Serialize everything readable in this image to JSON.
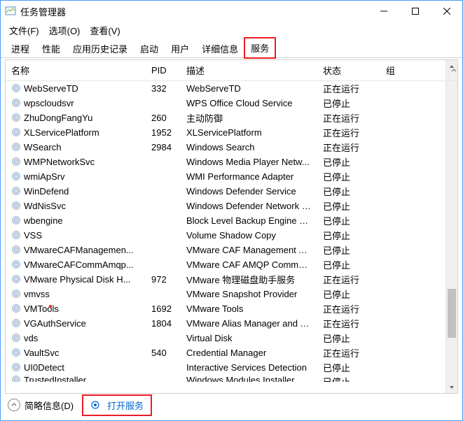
{
  "window": {
    "title": "任务管理器"
  },
  "menu": {
    "file": "文件(F)",
    "options": "选项(O)",
    "view": "查看(V)"
  },
  "tabs": {
    "processes": "进程",
    "performance": "性能",
    "history": "应用历史记录",
    "startup": "启动",
    "users": "用户",
    "details": "详细信息",
    "services": "服务"
  },
  "columns": {
    "name": "名称",
    "pid": "PID",
    "desc": "描述",
    "status": "状态",
    "group": "组"
  },
  "rows": [
    {
      "name": "WebServeTD",
      "pid": "332",
      "desc": "WebServeTD",
      "status": "正在运行"
    },
    {
      "name": "wpscloudsvr",
      "pid": "",
      "desc": "WPS Office Cloud Service",
      "status": "已停止"
    },
    {
      "name": "ZhuDongFangYu",
      "pid": "260",
      "desc": "主动防御",
      "status": "正在运行"
    },
    {
      "name": "XLServicePlatform",
      "pid": "1952",
      "desc": "XLServicePlatform",
      "status": "正在运行"
    },
    {
      "name": "WSearch",
      "pid": "2984",
      "desc": "Windows Search",
      "status": "正在运行"
    },
    {
      "name": "WMPNetworkSvc",
      "pid": "",
      "desc": "Windows Media Player Netw...",
      "status": "已停止"
    },
    {
      "name": "wmiApSrv",
      "pid": "",
      "desc": "WMI Performance Adapter",
      "status": "已停止"
    },
    {
      "name": "WinDefend",
      "pid": "",
      "desc": "Windows Defender Service",
      "status": "已停止"
    },
    {
      "name": "WdNisSvc",
      "pid": "",
      "desc": "Windows Defender Network I...",
      "status": "已停止"
    },
    {
      "name": "wbengine",
      "pid": "",
      "desc": "Block Level Backup Engine Se...",
      "status": "已停止"
    },
    {
      "name": "VSS",
      "pid": "",
      "desc": "Volume Shadow Copy",
      "status": "已停止"
    },
    {
      "name": "VMwareCAFManagemen...",
      "pid": "",
      "desc": "VMware CAF Management A...",
      "status": "已停止"
    },
    {
      "name": "VMwareCAFCommAmqp...",
      "pid": "",
      "desc": "VMware CAF AMQP Commun...",
      "status": "已停止"
    },
    {
      "name": "VMware Physical Disk H...",
      "pid": "972",
      "desc": "VMware 物理磁盘助手服务",
      "status": "正在运行"
    },
    {
      "name": "vmvss",
      "pid": "",
      "desc": "VMware Snapshot Provider",
      "status": "已停止"
    },
    {
      "name": "VMTools",
      "pid": "1692",
      "desc": "VMware Tools",
      "status": "正在运行"
    },
    {
      "name": "VGAuthService",
      "pid": "1804",
      "desc": "VMware Alias Manager and T...",
      "status": "正在运行"
    },
    {
      "name": "vds",
      "pid": "",
      "desc": "Virtual Disk",
      "status": "已停止"
    },
    {
      "name": "VaultSvc",
      "pid": "540",
      "desc": "Credential Manager",
      "status": "正在运行"
    },
    {
      "name": "UI0Detect",
      "pid": "",
      "desc": "Interactive Services Detection",
      "status": "已停止"
    }
  ],
  "partial_row": {
    "name": "TrustedInstaller",
    "desc": "Windows Modules Installer",
    "status": "已停止"
  },
  "footer": {
    "fewer": "简略信息(D)",
    "open_services": "打开服务"
  }
}
